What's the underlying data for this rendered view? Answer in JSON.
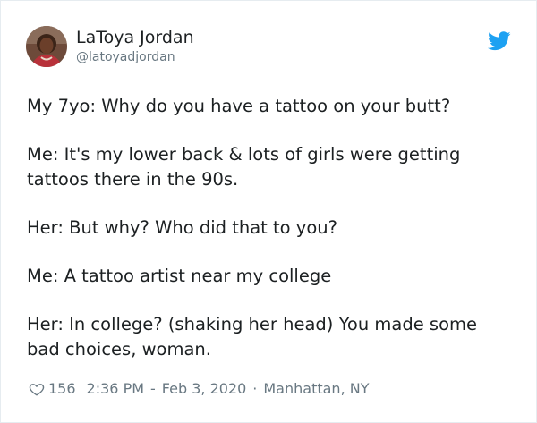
{
  "tweet": {
    "display_name": "LaToya Jordan",
    "handle": "@latoyadjordan",
    "paragraphs": [
      "My 7yo: Why do you have a tattoo on your butt?",
      "Me: It's my lower back & lots of girls were getting tattoos there in the 90s.",
      "Her: But why? Who did that to you?",
      "Me: A tattoo artist near my college",
      "Her: In college? (shaking her head) You made some bad choices, woman."
    ],
    "like_count": "156",
    "time": "2:36 PM",
    "date_sep": "-",
    "date": "Feb 3, 2020",
    "loc_sep": "·",
    "location": "Manhattan, NY"
  },
  "colors": {
    "text": "#1c2022",
    "secondary": "#697882",
    "brand": "#1da1f2",
    "border": "#e6ecf0"
  },
  "icons": {
    "brand": "twitter-bird-icon",
    "like": "heart-outline-icon"
  }
}
